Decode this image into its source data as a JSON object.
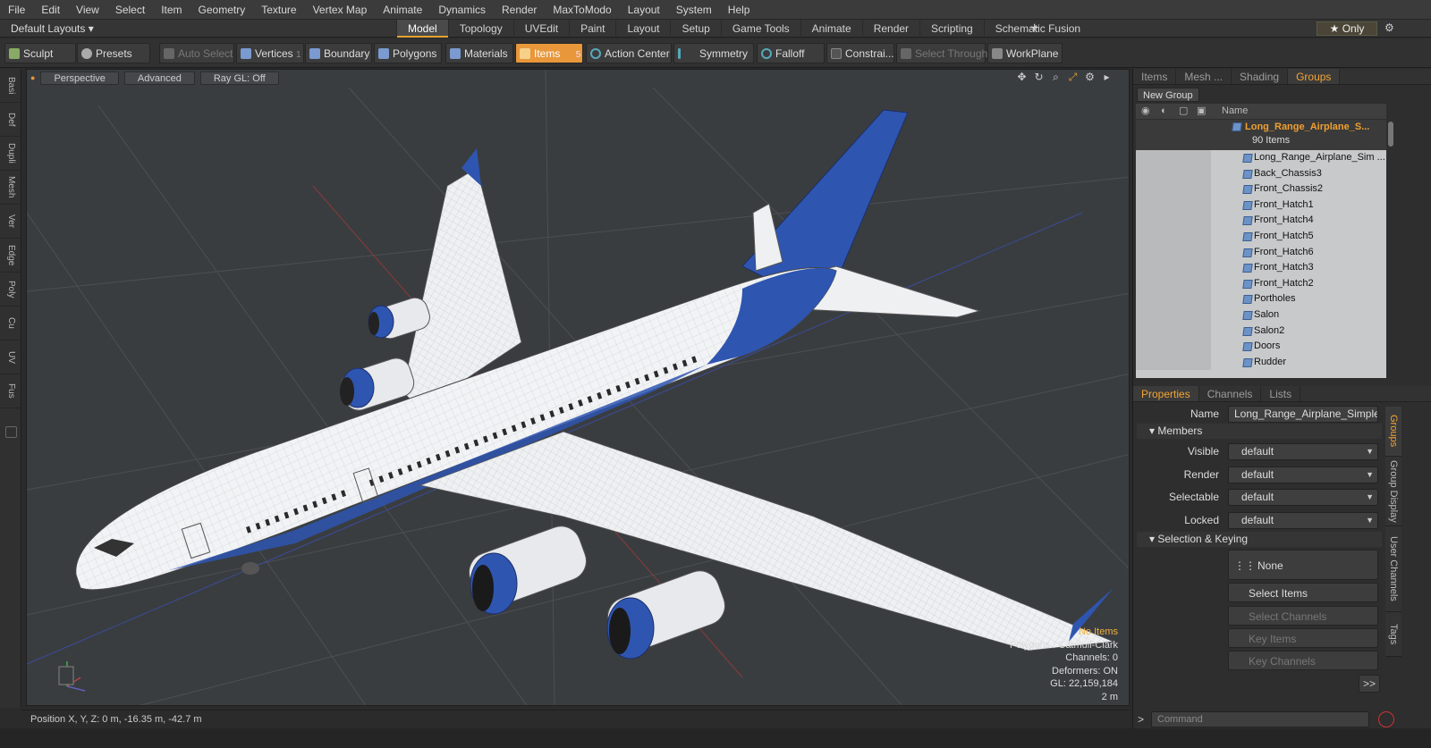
{
  "menu": [
    "File",
    "Edit",
    "View",
    "Select",
    "Item",
    "Geometry",
    "Texture",
    "Vertex Map",
    "Animate",
    "Dynamics",
    "Render",
    "MaxToModo",
    "Layout",
    "System",
    "Help"
  ],
  "layouts_label": "Default Layouts",
  "mode_tabs": [
    "Model",
    "Topology",
    "UVEdit",
    "Paint",
    "Layout",
    "Setup",
    "Game Tools",
    "Animate",
    "Render",
    "Scripting",
    "Schematic Fusion"
  ],
  "active_mode_tab": "Model",
  "only_label": "Only",
  "toolbar": {
    "sculpt": "Sculpt",
    "presets": "Presets",
    "auto_select": "Auto Select",
    "vertices": "Vertices",
    "vertices_count": "1",
    "boundary": "Boundary",
    "polygons": "Polygons",
    "materials": "Materials",
    "items": "Items",
    "items_count": "5",
    "action_center": "Action Center",
    "symmetry": "Symmetry",
    "falloff": "Falloff",
    "constrain": "Constrai...",
    "select_through": "Select Through",
    "workplane": "WorkPlane"
  },
  "left_tabs": [
    "Basi",
    "Def",
    "Dupli",
    "Mesh",
    "Ver",
    "Edge",
    "Poly",
    "Cu",
    "UV",
    "Fus"
  ],
  "viewport": {
    "view_mode": "Perspective",
    "shading": "Advanced",
    "raygl": "Ray GL: Off",
    "stats": {
      "selection": "No Items",
      "polygons": "Polygons : Catmull-Clark",
      "channels": "Channels: 0",
      "deformers": "Deformers: ON",
      "gl": "GL: 22,159,184",
      "scale": "2 m"
    },
    "colors": {
      "body": "#f2f3f5",
      "livery": "#2e55b0",
      "grid": "#4b4f53"
    }
  },
  "status": {
    "position": "Position X, Y, Z:   0 m, -16.35 m, -42.7 m"
  },
  "top_panel_tabs": [
    "Items",
    "Mesh ...",
    "Shading",
    "Groups"
  ],
  "active_top_tab": "Groups",
  "new_group": "New Group",
  "tree_header": "Name",
  "tree_root": {
    "label": "Long_Range_Airplane_S...",
    "count": "90 Items"
  },
  "tree_items": [
    "Long_Range_Airplane_Sim ...",
    "Back_Chassis3",
    "Front_Chassis2",
    "Front_Hatch1",
    "Front_Hatch4",
    "Front_Hatch5",
    "Front_Hatch6",
    "Front_Hatch3",
    "Front_Hatch2",
    "Portholes",
    "Salon",
    "Salon2",
    "Doors",
    "Rudder"
  ],
  "bottom_panel_tabs": [
    "Properties",
    "Channels",
    "Lists"
  ],
  "active_bottom_tab": "Properties",
  "props": {
    "name_label": "Name",
    "name_value": "Long_Range_Airplane_Simple_Ir",
    "members": "Members",
    "visible_label": "Visible",
    "visible_value": "default",
    "render_label": "Render",
    "render_value": "default",
    "selectable_label": "Selectable",
    "selectable_value": "default",
    "locked_label": "Locked",
    "locked_value": "default",
    "selection_keying": "Selection & Keying",
    "none_label": "None",
    "select_items": "Select Items",
    "select_channels": "Select Channels",
    "key_items": "Key Items",
    "key_channels": "Key Channels",
    "more": ">>"
  },
  "vertical_tabs": [
    "Groups",
    "Group Display",
    "User Channels",
    "Tags"
  ],
  "command_placeholder": "Command"
}
